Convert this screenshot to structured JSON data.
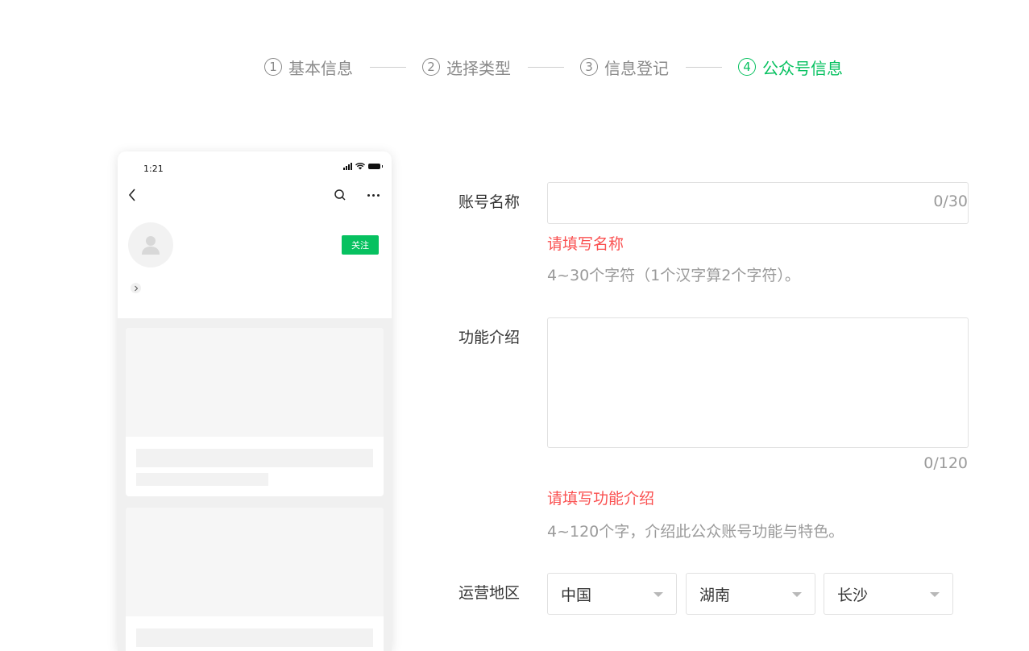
{
  "stepper": {
    "steps": [
      {
        "num": "1",
        "label": "基本信息"
      },
      {
        "num": "2",
        "label": "选择类型"
      },
      {
        "num": "3",
        "label": "信息登记"
      },
      {
        "num": "4",
        "label": "公众号信息"
      }
    ],
    "active_index": 3
  },
  "phone_preview": {
    "status_time": "1:21",
    "follow_label": "关注"
  },
  "form": {
    "name": {
      "label": "账号名称",
      "value": "",
      "counter": "0/30",
      "error": "请填写名称",
      "tip": "4~30个字符（1个汉字算2个字符）。"
    },
    "intro": {
      "label": "功能介绍",
      "value": "",
      "counter": "0/120",
      "error": "请填写功能介绍",
      "tip": "4~120个字，介绍此公众账号功能与特色。"
    },
    "region": {
      "label": "运营地区",
      "country": "中国",
      "province": "湖南",
      "city": "长沙"
    }
  },
  "colors": {
    "accent": "#07c160",
    "error": "#fa5151",
    "muted": "#9a9a9a"
  }
}
